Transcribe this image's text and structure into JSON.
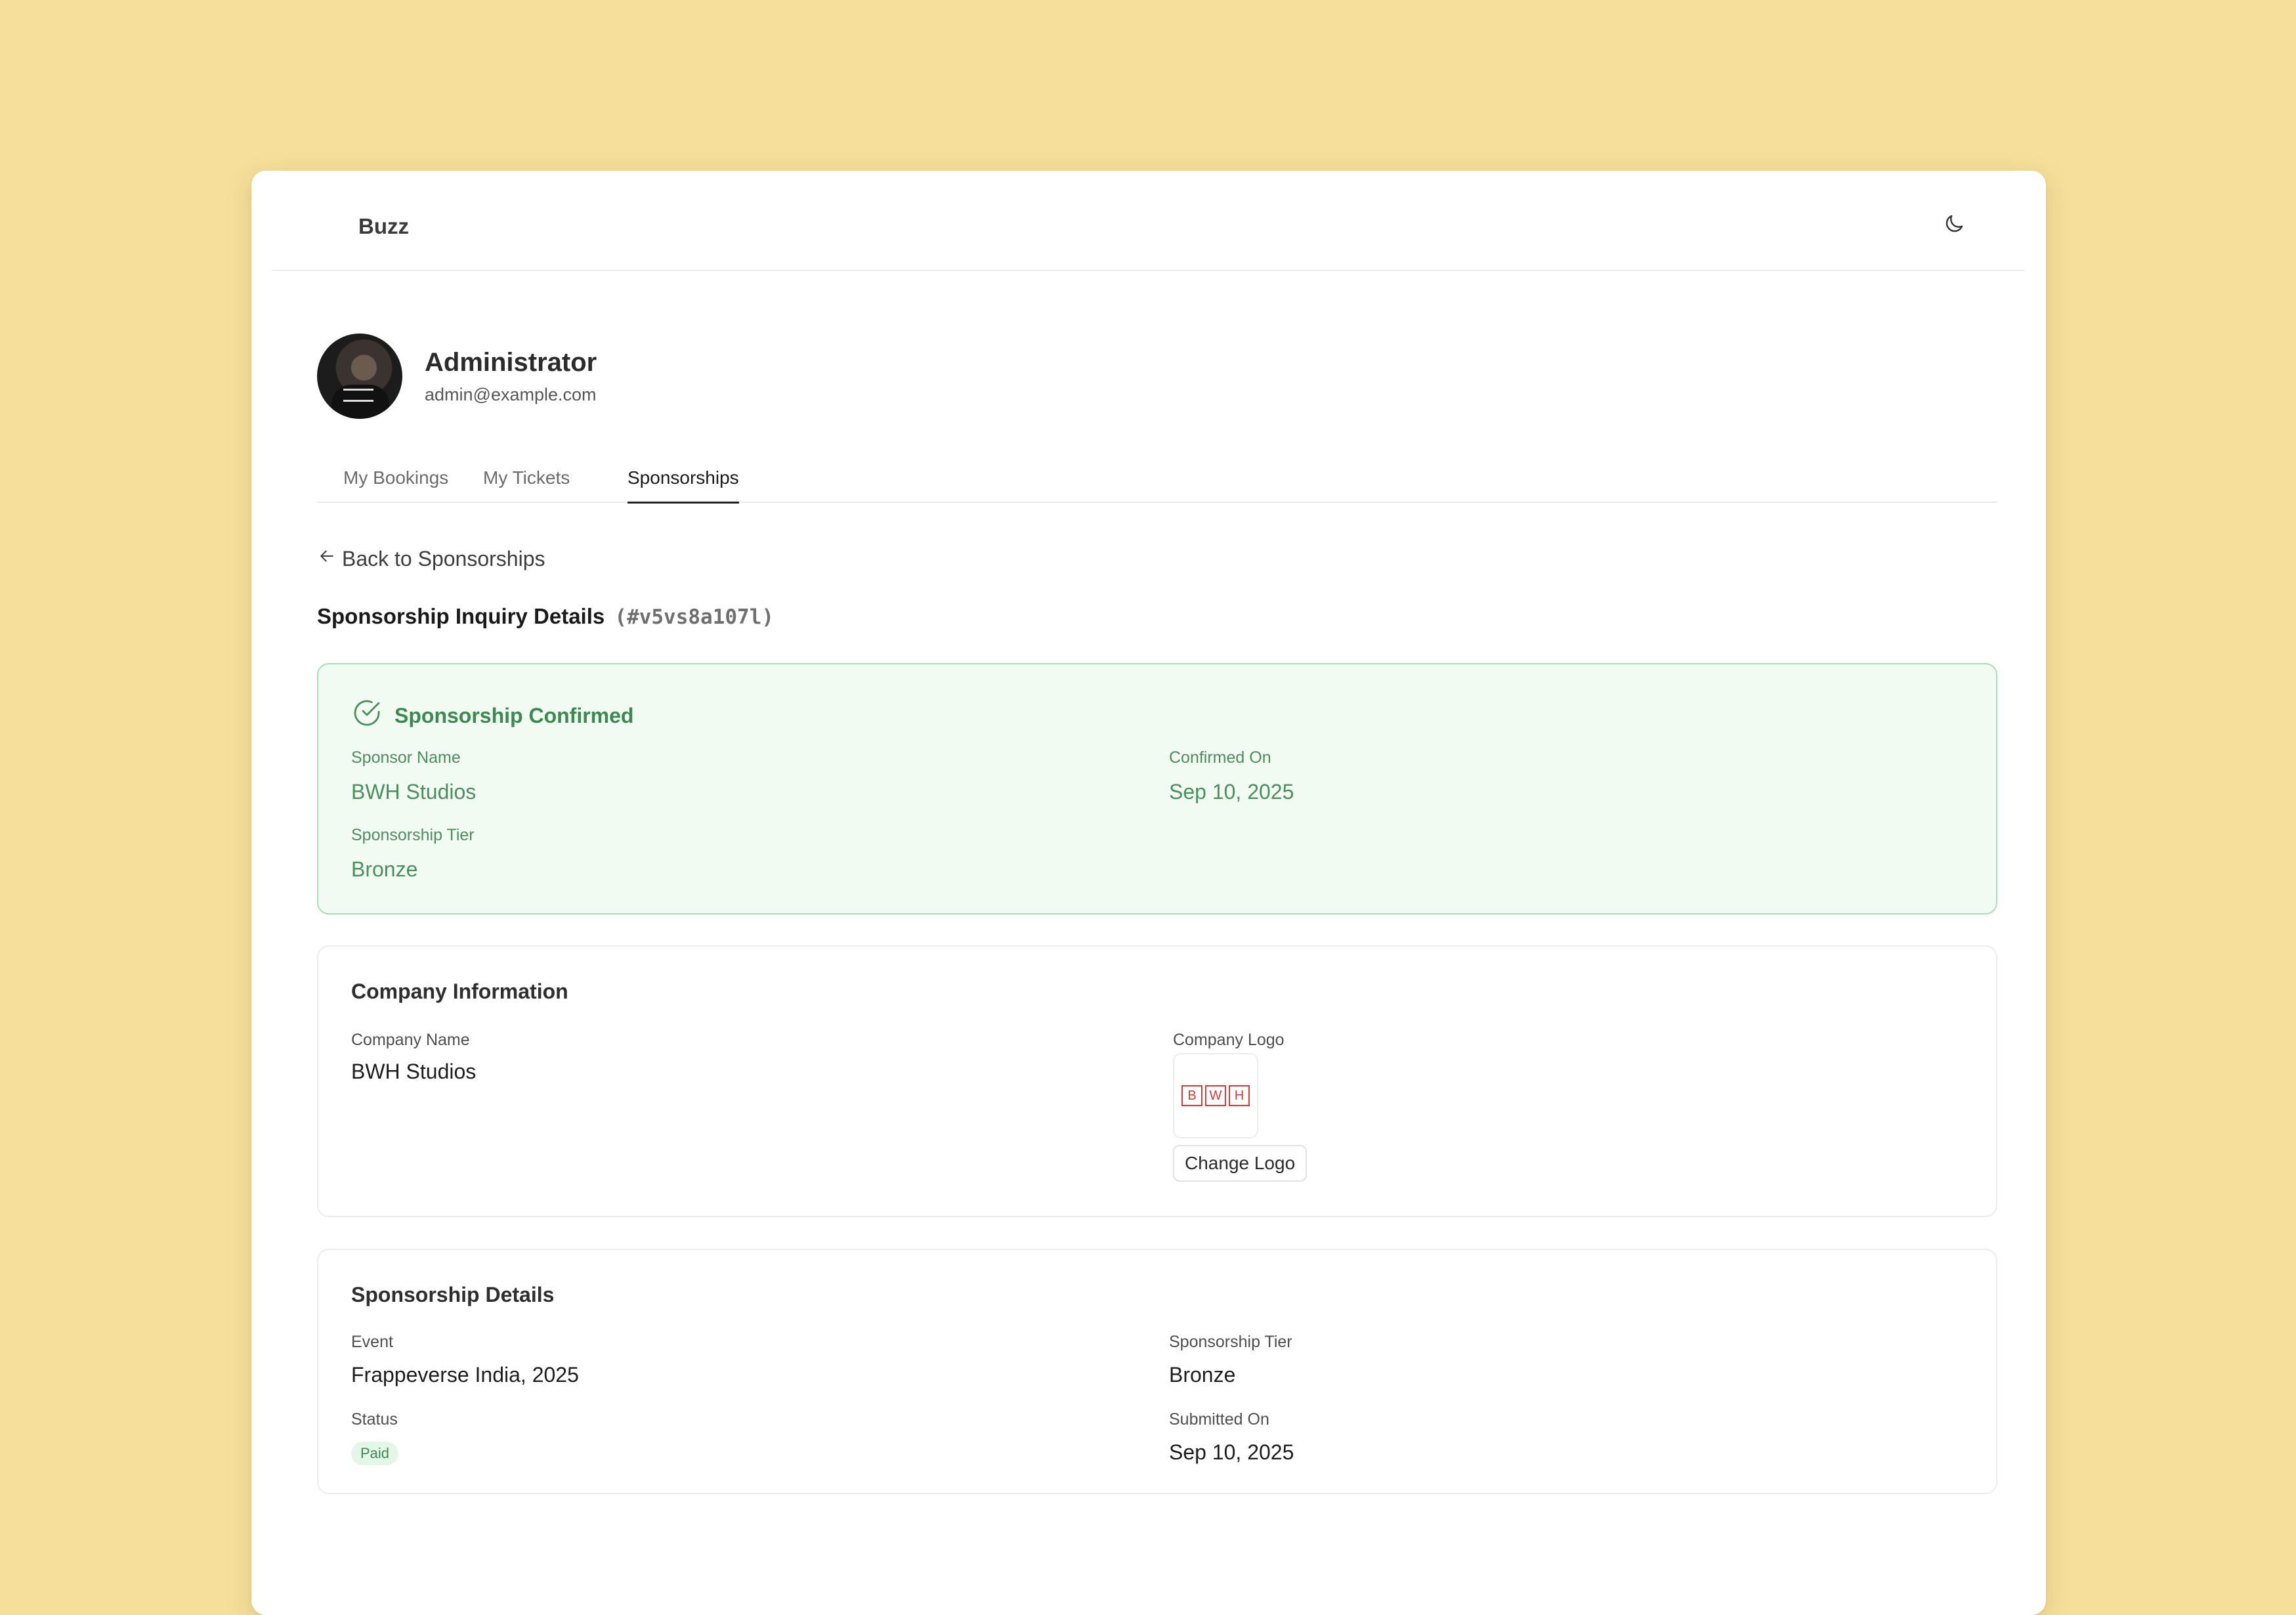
{
  "app": {
    "brand": "Buzz"
  },
  "profile": {
    "name": "Administrator",
    "email": "admin@example.com"
  },
  "tabs": [
    {
      "label": "My Bookings",
      "active": false
    },
    {
      "label": "My Tickets",
      "active": false
    },
    {
      "label": "Sponsorships",
      "active": true
    }
  ],
  "back_link": "Back to Sponsorships",
  "page_title": {
    "text": "Sponsorship Inquiry Details",
    "code": "(#v5vs8a107l)"
  },
  "confirmed_card": {
    "heading": "Sponsorship Confirmed",
    "sponsor_name_label": "Sponsor Name",
    "sponsor_name": "BWH Studios",
    "confirmed_on_label": "Confirmed On",
    "confirmed_on": "Sep 10, 2025",
    "tier_label": "Sponsorship Tier",
    "tier": "Bronze"
  },
  "company_card": {
    "heading": "Company Information",
    "company_name_label": "Company Name",
    "company_name": "BWH Studios",
    "logo_label": "Company Logo",
    "logo_letters": [
      "B",
      "W",
      "H"
    ],
    "change_logo": "Change Logo"
  },
  "details_card": {
    "heading": "Sponsorship Details",
    "event_label": "Event",
    "event": "Frappeverse India, 2025",
    "tier_label": "Sponsorship Tier",
    "tier": "Bronze",
    "status_label": "Status",
    "status": "Paid",
    "submitted_label": "Submitted On",
    "submitted": "Sep 10, 2025"
  },
  "colors": {
    "background": "#F5DF9A",
    "success": "#3c8a52",
    "logo_red": "#d63a3a"
  }
}
